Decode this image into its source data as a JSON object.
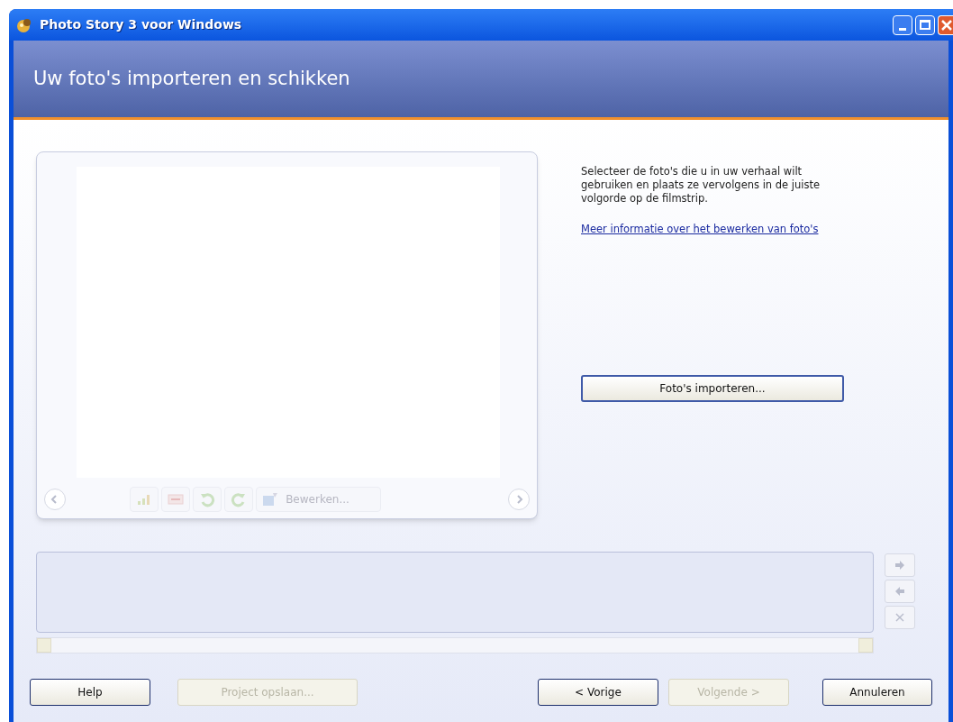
{
  "window": {
    "title": "Photo Story 3 voor Windows"
  },
  "header": {
    "title": "Uw foto's importeren en schikken"
  },
  "preview": {
    "toolbar": [
      {
        "kind": "levels",
        "disabled": true
      },
      {
        "kind": "redeye",
        "disabled": true
      },
      {
        "kind": "rotate-left",
        "disabled": true
      },
      {
        "kind": "rotate-right",
        "disabled": true
      },
      {
        "kind": "edit",
        "label": "Bewerken...",
        "disabled": true
      }
    ]
  },
  "instructions": "Selecteer de foto's die u in uw verhaal wilt gebruiken en plaats ze vervolgens in de juiste volgorde op de filmstrip.",
  "help_link": "Meer informatie over het bewerken van foto's",
  "import_button": {
    "label": "Foto's importeren...",
    "disabled": false
  },
  "filmstrip_buttons": [
    {
      "kind": "right",
      "disabled": true
    },
    {
      "kind": "left",
      "disabled": true
    },
    {
      "kind": "remove",
      "label": "×",
      "disabled": true
    }
  ],
  "buttons": [
    {
      "label": "Help",
      "disabled": false
    },
    {
      "label": "Project opslaan...",
      "disabled": true
    },
    {
      "label": "< Vorige",
      "disabled": false
    },
    {
      "label": "Volgende >",
      "disabled": true
    },
    {
      "label": "Annuleren",
      "disabled": false
    }
  ]
}
